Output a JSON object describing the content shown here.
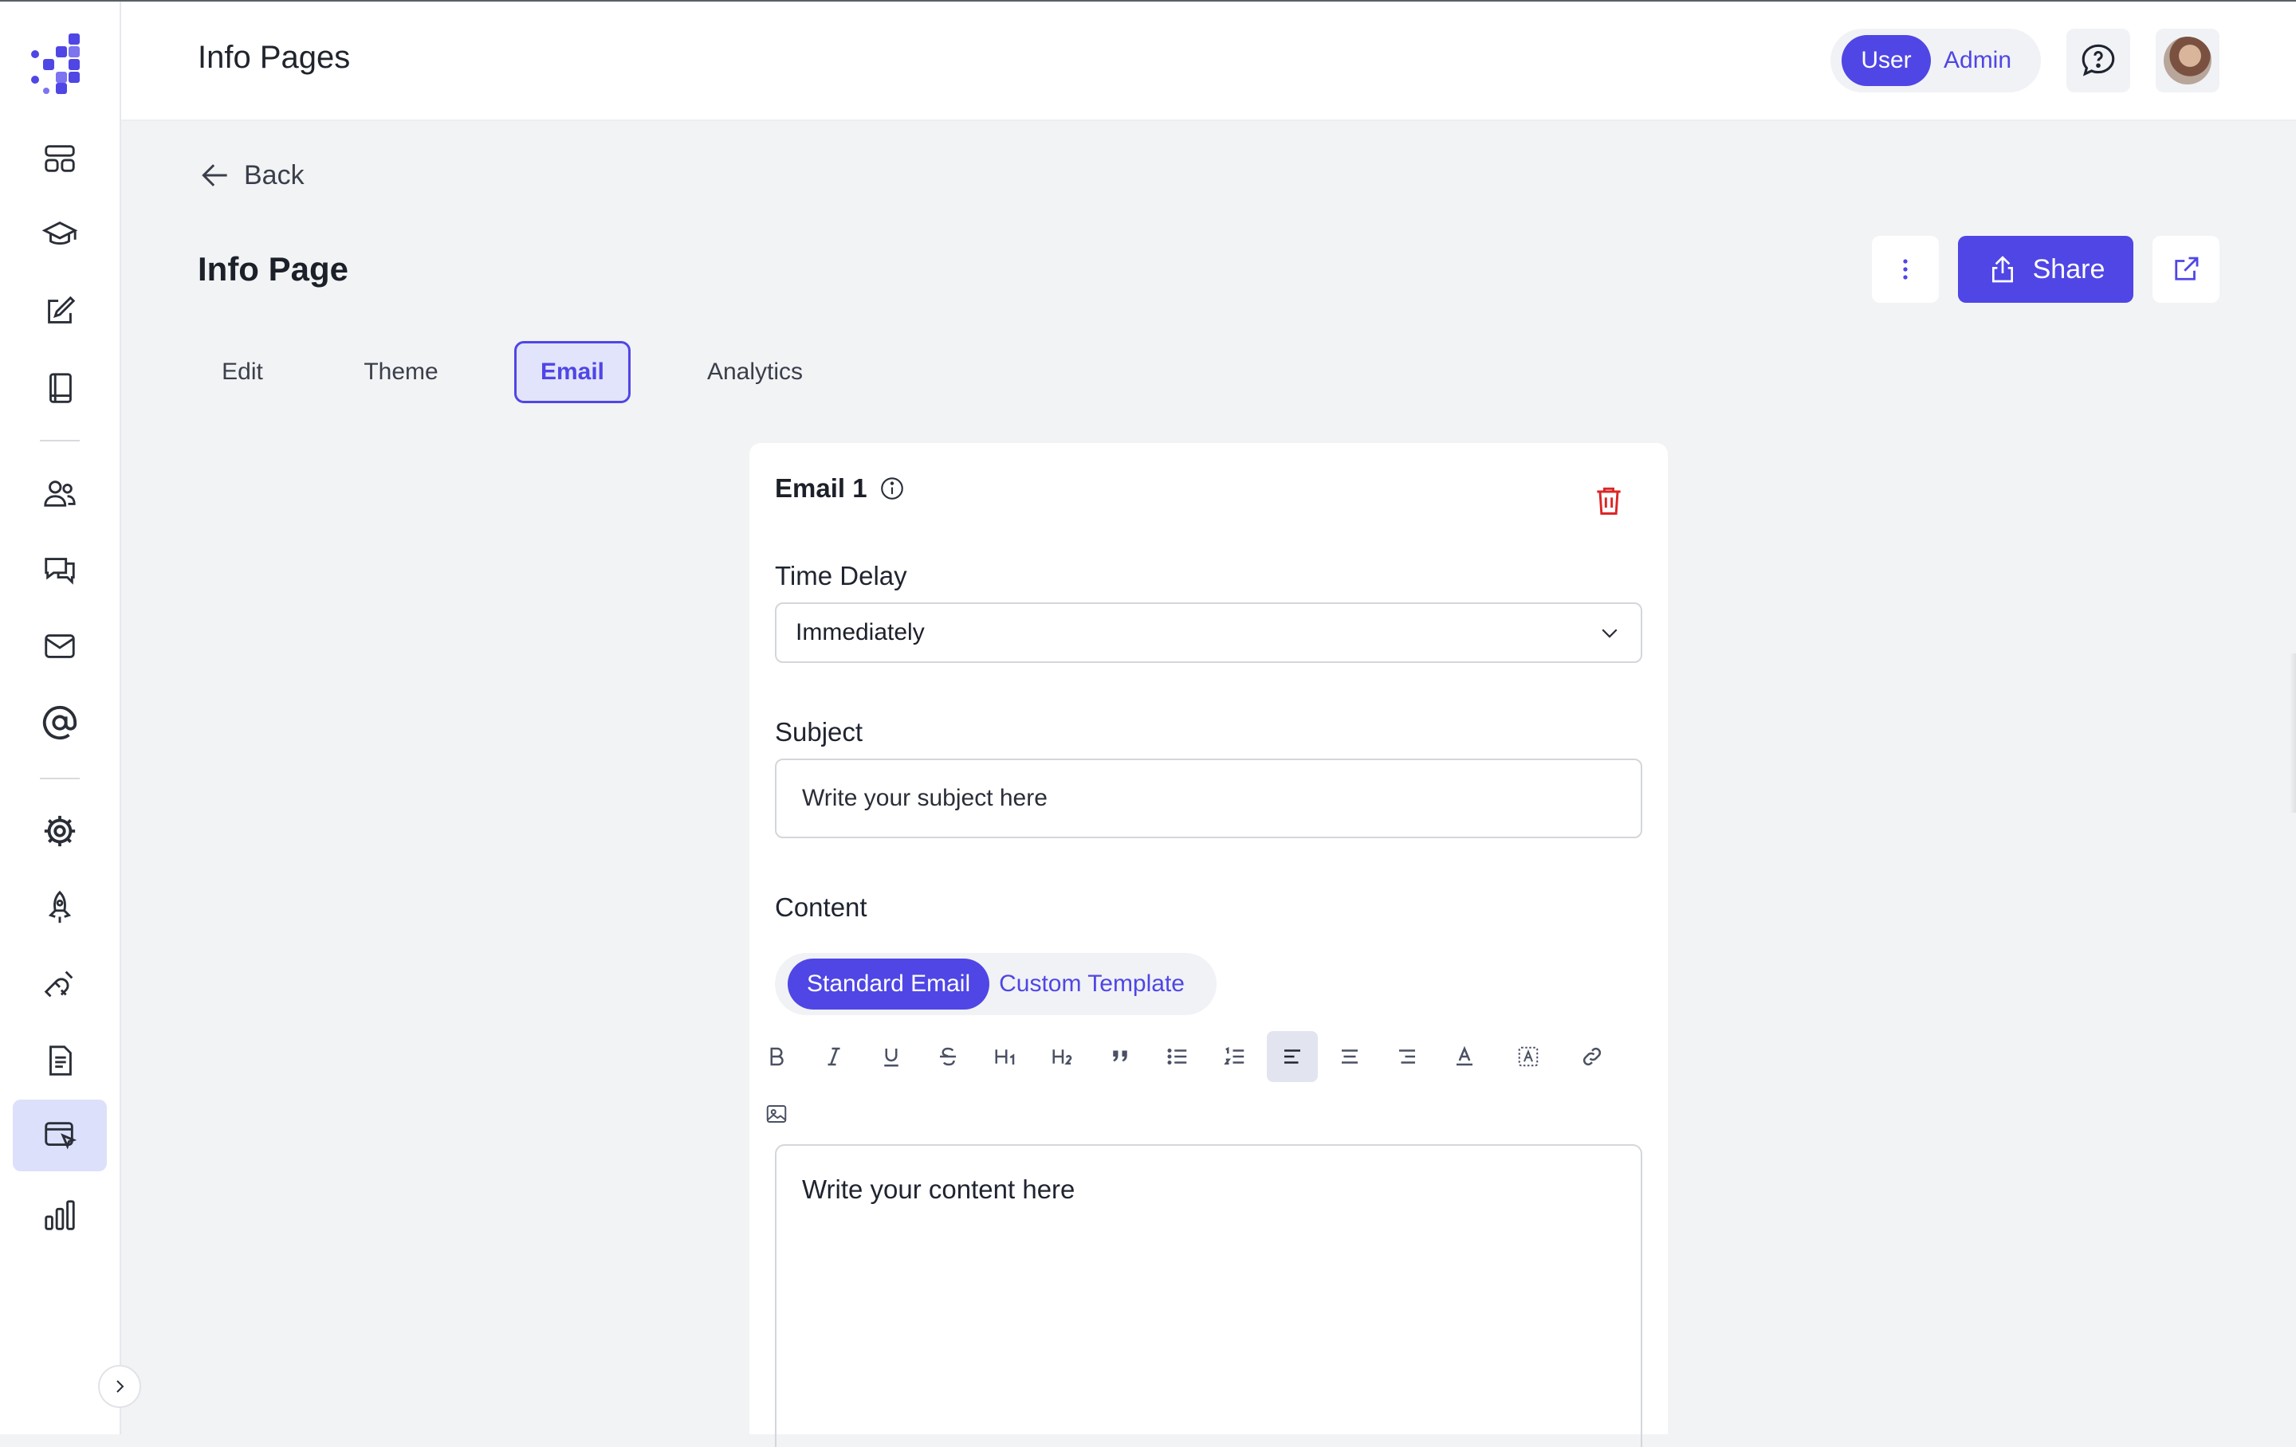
{
  "header": {
    "title": "Info Pages",
    "role_user": "User",
    "role_admin": "Admin"
  },
  "sidebar": {
    "items": [
      {
        "icon": "dashboard-icon"
      },
      {
        "icon": "graduation-cap-icon"
      },
      {
        "icon": "edit-icon"
      },
      {
        "icon": "book-icon"
      },
      {
        "icon": "users-icon"
      },
      {
        "icon": "chat-icon"
      },
      {
        "icon": "mail-icon"
      },
      {
        "icon": "at-sign-icon"
      },
      {
        "icon": "gear-icon"
      },
      {
        "icon": "rocket-icon"
      },
      {
        "icon": "magnet-icon"
      },
      {
        "icon": "document-icon"
      },
      {
        "icon": "browser-cursor-icon",
        "active": true
      },
      {
        "icon": "bar-chart-icon"
      }
    ]
  },
  "page": {
    "back_label": "Back",
    "title": "Info Page",
    "share_label": "Share"
  },
  "tabs": [
    {
      "label": "Edit"
    },
    {
      "label": "Theme"
    },
    {
      "label": "Email",
      "active": true
    },
    {
      "label": "Analytics"
    }
  ],
  "email": {
    "title": "Email 1",
    "time_delay_label": "Time Delay",
    "time_delay_value": "Immediately",
    "subject_label": "Subject",
    "subject_placeholder": "Write your subject here",
    "content_label": "Content",
    "content_modes": [
      "Standard Email",
      "Custom Template"
    ],
    "selected_mode": "Standard Email",
    "editor_placeholder": "Write your content here",
    "toolbar": [
      "bold",
      "italic",
      "underline",
      "strikethrough",
      "heading-1",
      "heading-2",
      "quote",
      "bullet-list",
      "ordered-list",
      "align-left",
      "align-center",
      "align-right",
      "text-color",
      "highlight",
      "link",
      "image"
    ],
    "active_tool": "align-left"
  },
  "colors": {
    "accent": "#4f46e5",
    "accent_light": "#e2e4fb",
    "danger": "#dc2626",
    "background": "#f2f3f5"
  }
}
